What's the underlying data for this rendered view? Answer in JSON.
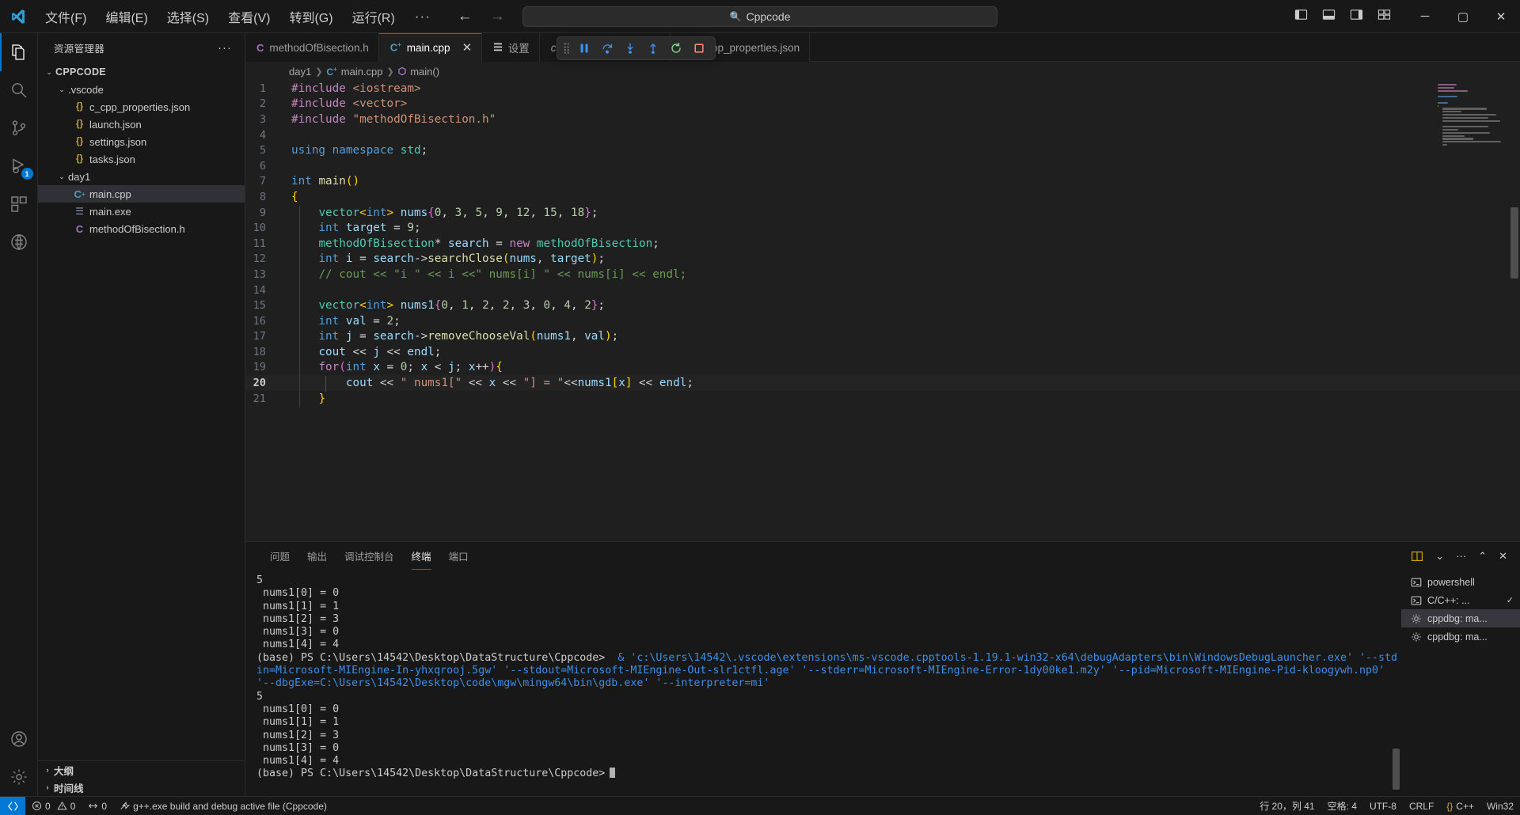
{
  "titlebar": {
    "menus": [
      "文件(F)",
      "编辑(E)",
      "选择(S)",
      "查看(V)",
      "转到(G)",
      "运行(R)"
    ],
    "more": "···",
    "back_icon": "arrow-left-icon",
    "forward_icon": "arrow-right-icon",
    "search_text": "Cppcode",
    "search_icon": "search-icon",
    "window_controls": {
      "minimize": "─",
      "maximize": "▢",
      "close": "✕"
    }
  },
  "activitybar": {
    "items": [
      {
        "name": "explorer",
        "icon": "files-icon",
        "active": true,
        "badge": ""
      },
      {
        "name": "search",
        "icon": "search-icon",
        "active": false,
        "badge": ""
      },
      {
        "name": "source-control",
        "icon": "source-control-icon",
        "active": false,
        "badge": ""
      },
      {
        "name": "run-and-debug",
        "icon": "debug-icon",
        "active": false,
        "badge": "1"
      },
      {
        "name": "extensions",
        "icon": "extensions-icon",
        "active": false,
        "badge": ""
      },
      {
        "name": "remote-explorer",
        "icon": "remote-icon",
        "active": false,
        "badge": ""
      }
    ],
    "bottom": [
      {
        "name": "accounts",
        "icon": "account-icon"
      },
      {
        "name": "settings",
        "icon": "gear-icon"
      }
    ]
  },
  "sidebar": {
    "title": "资源管理器",
    "more_label": "···",
    "root": "CPPCODE",
    "tree": [
      {
        "label": ".vscode",
        "type": "folder",
        "indent": 1,
        "expanded": true
      },
      {
        "label": "c_cpp_properties.json",
        "type": "json",
        "indent": 2
      },
      {
        "label": "launch.json",
        "type": "json",
        "indent": 2
      },
      {
        "label": "settings.json",
        "type": "json",
        "indent": 2
      },
      {
        "label": "tasks.json",
        "type": "json",
        "indent": 2
      },
      {
        "label": "day1",
        "type": "folder",
        "indent": 1,
        "expanded": true
      },
      {
        "label": "main.cpp",
        "type": "cpp",
        "indent": 2,
        "selected": true
      },
      {
        "label": "main.exe",
        "type": "exe",
        "indent": 2
      },
      {
        "label": "methodOfBisection.h",
        "type": "h",
        "indent": 2
      }
    ],
    "sections": [
      "大纲",
      "时间线"
    ]
  },
  "tabs": [
    {
      "label": "methodOfBisection.h",
      "icon": "h",
      "active": false,
      "closable": false
    },
    {
      "label": "main.cpp",
      "icon": "cpp",
      "active": true,
      "closable": true
    },
    {
      "label": "设置",
      "icon": "settings",
      "active": false,
      "closable": false
    },
    {
      "label": "cumentation Generator",
      "icon": "none",
      "active": false,
      "italic": true
    },
    {
      "label": "c_cpp_properties.json",
      "icon": "json",
      "active": false
    }
  ],
  "debug_toolbar": {
    "grip": "⠿",
    "buttons": [
      "pause-icon",
      "step-over-icon",
      "step-into-icon",
      "step-out-icon",
      "restart-icon",
      "stop-icon"
    ]
  },
  "breadcrumb": {
    "folder": "day1",
    "file": "main.cpp",
    "symbol": "main()"
  },
  "editor": {
    "current_line": 20,
    "lines": [
      {
        "n": 1,
        "tokens": [
          [
            "k-pre",
            "#include"
          ],
          [
            "k-op",
            " "
          ],
          [
            "k-str",
            "<iostream>"
          ]
        ]
      },
      {
        "n": 2,
        "tokens": [
          [
            "k-pre",
            "#include"
          ],
          [
            "k-op",
            " "
          ],
          [
            "k-str",
            "<vector>"
          ]
        ]
      },
      {
        "n": 3,
        "tokens": [
          [
            "k-pre",
            "#include"
          ],
          [
            "k-op",
            " "
          ],
          [
            "k-str",
            "\"methodOfBisection.h\""
          ]
        ]
      },
      {
        "n": 4,
        "tokens": []
      },
      {
        "n": 5,
        "tokens": [
          [
            "k-kw",
            "using"
          ],
          [
            "k-op",
            " "
          ],
          [
            "k-kw",
            "namespace"
          ],
          [
            "k-op",
            " "
          ],
          [
            "k-type",
            "std"
          ],
          [
            "k-op",
            ";"
          ]
        ]
      },
      {
        "n": 6,
        "tokens": []
      },
      {
        "n": 7,
        "tokens": [
          [
            "k-kw",
            "int"
          ],
          [
            "k-op",
            " "
          ],
          [
            "k-fn",
            "main"
          ],
          [
            "b-y",
            "()"
          ]
        ]
      },
      {
        "n": 8,
        "tokens": [
          [
            "b-y",
            "{"
          ]
        ]
      },
      {
        "n": 9,
        "tokens": [
          [
            "k-op",
            "    "
          ],
          [
            "k-type",
            "vector"
          ],
          [
            "b-y",
            "<"
          ],
          [
            "k-kw",
            "int"
          ],
          [
            "b-y",
            ">"
          ],
          [
            "k-op",
            " "
          ],
          [
            "k-var",
            "nums"
          ],
          [
            "b-p",
            "{"
          ],
          [
            "k-num",
            "0"
          ],
          [
            "k-op",
            ", "
          ],
          [
            "k-num",
            "3"
          ],
          [
            "k-op",
            ", "
          ],
          [
            "k-num",
            "5"
          ],
          [
            "k-op",
            ", "
          ],
          [
            "k-num",
            "9"
          ],
          [
            "k-op",
            ", "
          ],
          [
            "k-num",
            "12"
          ],
          [
            "k-op",
            ", "
          ],
          [
            "k-num",
            "15"
          ],
          [
            "k-op",
            ", "
          ],
          [
            "k-num",
            "18"
          ],
          [
            "b-p",
            "}"
          ],
          [
            "k-op",
            ";"
          ]
        ]
      },
      {
        "n": 10,
        "tokens": [
          [
            "k-op",
            "    "
          ],
          [
            "k-kw",
            "int"
          ],
          [
            "k-op",
            " "
          ],
          [
            "k-var",
            "target"
          ],
          [
            "k-op",
            " = "
          ],
          [
            "k-num",
            "9"
          ],
          [
            "k-op",
            ";"
          ]
        ]
      },
      {
        "n": 11,
        "tokens": [
          [
            "k-op",
            "    "
          ],
          [
            "k-type",
            "methodOfBisection"
          ],
          [
            "k-op",
            "* "
          ],
          [
            "k-var",
            "search"
          ],
          [
            "k-op",
            " = "
          ],
          [
            "k-ctrl",
            "new"
          ],
          [
            "k-op",
            " "
          ],
          [
            "k-type",
            "methodOfBisection"
          ],
          [
            "k-op",
            ";"
          ]
        ]
      },
      {
        "n": 12,
        "tokens": [
          [
            "k-op",
            "    "
          ],
          [
            "k-kw",
            "int"
          ],
          [
            "k-op",
            " "
          ],
          [
            "k-var",
            "i"
          ],
          [
            "k-op",
            " = "
          ],
          [
            "k-var",
            "search"
          ],
          [
            "k-op",
            "->"
          ],
          [
            "k-fn",
            "searchClose"
          ],
          [
            "b-y",
            "("
          ],
          [
            "k-var",
            "nums"
          ],
          [
            "k-op",
            ", "
          ],
          [
            "k-var",
            "target"
          ],
          [
            "b-y",
            ")"
          ],
          [
            "k-op",
            ";"
          ]
        ]
      },
      {
        "n": 13,
        "tokens": [
          [
            "k-op",
            "    "
          ],
          [
            "k-com",
            "// cout << \"i \" << i <<\" nums[i] \" << nums[i] << endl;"
          ]
        ]
      },
      {
        "n": 14,
        "tokens": []
      },
      {
        "n": 15,
        "tokens": [
          [
            "k-op",
            "    "
          ],
          [
            "k-type",
            "vector"
          ],
          [
            "b-y",
            "<"
          ],
          [
            "k-kw",
            "int"
          ],
          [
            "b-y",
            ">"
          ],
          [
            "k-op",
            " "
          ],
          [
            "k-var",
            "nums1"
          ],
          [
            "b-p",
            "{"
          ],
          [
            "k-num",
            "0"
          ],
          [
            "k-op",
            ", "
          ],
          [
            "k-num",
            "1"
          ],
          [
            "k-op",
            ", "
          ],
          [
            "k-num",
            "2"
          ],
          [
            "k-op",
            ", "
          ],
          [
            "k-num",
            "2"
          ],
          [
            "k-op",
            ", "
          ],
          [
            "k-num",
            "3"
          ],
          [
            "k-op",
            ", "
          ],
          [
            "k-num",
            "0"
          ],
          [
            "k-op",
            ", "
          ],
          [
            "k-num",
            "4"
          ],
          [
            "k-op",
            ", "
          ],
          [
            "k-num",
            "2"
          ],
          [
            "b-p",
            "}"
          ],
          [
            "k-op",
            ";"
          ]
        ]
      },
      {
        "n": 16,
        "tokens": [
          [
            "k-op",
            "    "
          ],
          [
            "k-kw",
            "int"
          ],
          [
            "k-op",
            " "
          ],
          [
            "k-var",
            "val"
          ],
          [
            "k-op",
            " = "
          ],
          [
            "k-num",
            "2"
          ],
          [
            "k-op",
            ";"
          ]
        ]
      },
      {
        "n": 17,
        "tokens": [
          [
            "k-op",
            "    "
          ],
          [
            "k-kw",
            "int"
          ],
          [
            "k-op",
            " "
          ],
          [
            "k-var",
            "j"
          ],
          [
            "k-op",
            " = "
          ],
          [
            "k-var",
            "search"
          ],
          [
            "k-op",
            "->"
          ],
          [
            "k-fn",
            "removeChooseVal"
          ],
          [
            "b-y",
            "("
          ],
          [
            "k-var",
            "nums1"
          ],
          [
            "k-op",
            ", "
          ],
          [
            "k-var",
            "val"
          ],
          [
            "b-y",
            ")"
          ],
          [
            "k-op",
            ";"
          ]
        ]
      },
      {
        "n": 18,
        "tokens": [
          [
            "k-op",
            "    "
          ],
          [
            "k-var",
            "cout"
          ],
          [
            "k-op",
            " << "
          ],
          [
            "k-var",
            "j"
          ],
          [
            "k-op",
            " << "
          ],
          [
            "k-var",
            "endl"
          ],
          [
            "k-op",
            ";"
          ]
        ]
      },
      {
        "n": 19,
        "tokens": [
          [
            "k-op",
            "    "
          ],
          [
            "k-ctrl",
            "for"
          ],
          [
            "b-p",
            "("
          ],
          [
            "k-kw",
            "int"
          ],
          [
            "k-op",
            " "
          ],
          [
            "k-var",
            "x"
          ],
          [
            "k-op",
            " = "
          ],
          [
            "k-num",
            "0"
          ],
          [
            "k-op",
            "; "
          ],
          [
            "k-var",
            "x"
          ],
          [
            "k-op",
            " < "
          ],
          [
            "k-var",
            "j"
          ],
          [
            "k-op",
            "; "
          ],
          [
            "k-var",
            "x"
          ],
          [
            "k-op",
            "++"
          ],
          [
            "b-p",
            ")"
          ],
          [
            "b-y",
            "{"
          ]
        ]
      },
      {
        "n": 20,
        "tokens": [
          [
            "k-op",
            "        "
          ],
          [
            "k-var",
            "cout"
          ],
          [
            "k-op",
            " << "
          ],
          [
            "k-str",
            "\" nums1[\""
          ],
          [
            "k-op",
            " << "
          ],
          [
            "k-var",
            "x"
          ],
          [
            "k-op",
            " << "
          ],
          [
            "k-str",
            "\"] = \""
          ],
          [
            "k-op",
            "<<"
          ],
          [
            "k-var",
            "nums1"
          ],
          [
            "b-y",
            "["
          ],
          [
            "k-var",
            "x"
          ],
          [
            "b-y",
            "]"
          ],
          [
            "k-op",
            " << "
          ],
          [
            "k-var",
            "endl"
          ],
          [
            "k-op",
            ";"
          ]
        ]
      },
      {
        "n": 21,
        "tokens": [
          [
            "k-op",
            "    "
          ],
          [
            "b-y",
            "}"
          ]
        ]
      }
    ]
  },
  "panel": {
    "tabs": [
      "问题",
      "输出",
      "调试控制台",
      "终端",
      "端口"
    ],
    "active_tab": "终端",
    "actions": [
      "split-terminal-icon",
      "chevron-down-icon",
      "more-icon",
      "maximize-panel-icon",
      "close-panel-icon"
    ],
    "terminal_lines": [
      {
        "text": "5",
        "cls": ""
      },
      {
        "text": " nums1[0] = 0",
        "cls": ""
      },
      {
        "text": " nums1[1] = 1",
        "cls": ""
      },
      {
        "text": " nums1[2] = 3",
        "cls": ""
      },
      {
        "text": " nums1[3] = 0",
        "cls": ""
      },
      {
        "text": " nums1[4] = 4",
        "cls": ""
      },
      {
        "text": "(base) PS C:\\Users\\14542\\Desktop\\DataStructure\\Cppcode>",
        "cls": "",
        "suffix_cyan": "  & 'c:\\Users\\14542\\.vscode\\extensions\\ms-vscode.cpptools-1.19.1-win32-x64\\debugAdapters\\bin\\WindowsDebugLauncher.exe' '--stdin=Microsoft-MIEngine-In-yhxqrooj.5gw' '--stdout=Microsoft-MIEngine-Out-slr1ctfl.age' '--stderr=Microsoft-MIEngine-Error-1dy00ke1.m2y' '--pid=Microsoft-MIEngine-Pid-kloogywh.np0' '--dbgExe=C:\\Users\\14542\\Desktop\\code\\mgw\\mingw64\\bin\\gdb.exe' '--interpreter=mi'"
      },
      {
        "text": "5",
        "cls": ""
      },
      {
        "text": " nums1[0] = 0",
        "cls": ""
      },
      {
        "text": " nums1[1] = 1",
        "cls": ""
      },
      {
        "text": " nums1[2] = 3",
        "cls": ""
      },
      {
        "text": " nums1[3] = 0",
        "cls": ""
      },
      {
        "text": " nums1[4] = 4",
        "cls": ""
      },
      {
        "text": "(base) PS C:\\Users\\14542\\Desktop\\DataStructure\\Cppcode>",
        "cls": "",
        "cursor": true
      }
    ],
    "terminal_list": [
      {
        "label": "powershell",
        "icon": "terminal-icon",
        "active": false,
        "check": false
      },
      {
        "label": "C/C++: ...",
        "icon": "terminal-icon",
        "active": false,
        "check": true
      },
      {
        "label": "cppdbg: ma...",
        "icon": "debug-gear-icon",
        "active": true,
        "check": false
      },
      {
        "label": "cppdbg: ma...",
        "icon": "debug-gear-icon",
        "active": false,
        "check": false
      }
    ]
  },
  "statusbar": {
    "remote_icon": "remote-icon",
    "errors": "0",
    "warnings": "0",
    "ports": "0",
    "task": "g++.exe build and debug active file (Cppcode)",
    "position": "行 20，列 41",
    "indent": "空格: 4",
    "encoding": "UTF-8",
    "eol": "CRLF",
    "language": "C++",
    "platform": "Win32"
  },
  "colors": {
    "accent": "#0078d4",
    "bg": "#1f1f1f",
    "chrome": "#181818",
    "selection": "#2f3136"
  }
}
